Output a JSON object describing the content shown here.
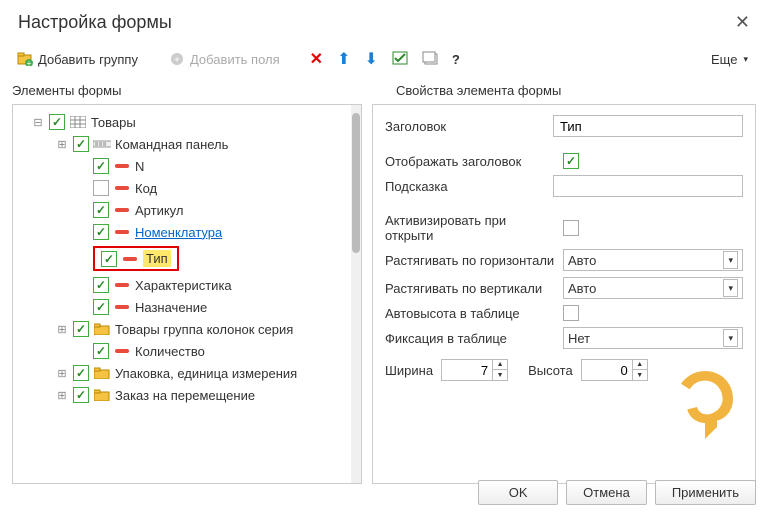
{
  "title": "Настройка формы",
  "toolbar": {
    "add_group": "Добавить группу",
    "add_fields": "Добавить поля",
    "more": "Еще"
  },
  "columns": {
    "left": "Элементы формы",
    "right": "Свойства элемента формы"
  },
  "tree": [
    {
      "level": 0,
      "exp": "minus",
      "checked": true,
      "icon": "grid",
      "label": "Товары"
    },
    {
      "level": 1,
      "exp": "plus",
      "checked": true,
      "icon": "cmd",
      "label": "Командная панель"
    },
    {
      "level": 2,
      "exp": "",
      "checked": true,
      "icon": "minus",
      "label": "N"
    },
    {
      "level": 2,
      "exp": "",
      "checked": false,
      "icon": "minus",
      "label": "Код"
    },
    {
      "level": 2,
      "exp": "",
      "checked": true,
      "icon": "minus",
      "label": "Артикул"
    },
    {
      "level": 2,
      "exp": "",
      "checked": true,
      "icon": "minus",
      "label": "Номенклатура",
      "link": true
    },
    {
      "level": 2,
      "exp": "",
      "checked": true,
      "icon": "minus",
      "label": "Тип",
      "highlighted": true
    },
    {
      "level": 2,
      "exp": "",
      "checked": true,
      "icon": "minus",
      "label": "Характеристика"
    },
    {
      "level": 2,
      "exp": "",
      "checked": true,
      "icon": "minus",
      "label": "Назначение"
    },
    {
      "level": 1,
      "exp": "plus",
      "checked": true,
      "icon": "folder",
      "label": "Товары группа колонок серия"
    },
    {
      "level": 2,
      "exp": "",
      "checked": true,
      "icon": "minus",
      "label": "Количество"
    },
    {
      "level": 1,
      "exp": "plus",
      "checked": true,
      "icon": "folder",
      "label": "Упаковка, единица измерения"
    },
    {
      "level": 1,
      "exp": "plus",
      "checked": true,
      "icon": "folder",
      "label": "Заказ на перемещение"
    }
  ],
  "props": {
    "header_label": "Заголовок",
    "header_value": "Тип",
    "show_header_label": "Отображать заголовок",
    "show_header_checked": true,
    "hint_label": "Подсказка",
    "hint_value": "",
    "activate_label": "Активизировать при открыти",
    "activate_checked": false,
    "stretch_h_label": "Растягивать по горизонтали",
    "stretch_h_value": "Авто",
    "stretch_v_label": "Растягивать по вертикали",
    "stretch_v_value": "Авто",
    "autoheight_label": "Автовысота в таблице",
    "autoheight_checked": false,
    "fixation_label": "Фиксация в таблице",
    "fixation_value": "Нет",
    "width_label": "Ширина",
    "width_value": "7",
    "height_label": "Высота",
    "height_value": "0"
  },
  "footer": {
    "ok": "OK",
    "cancel": "Отмена",
    "apply": "Применить"
  },
  "help_text": "?"
}
